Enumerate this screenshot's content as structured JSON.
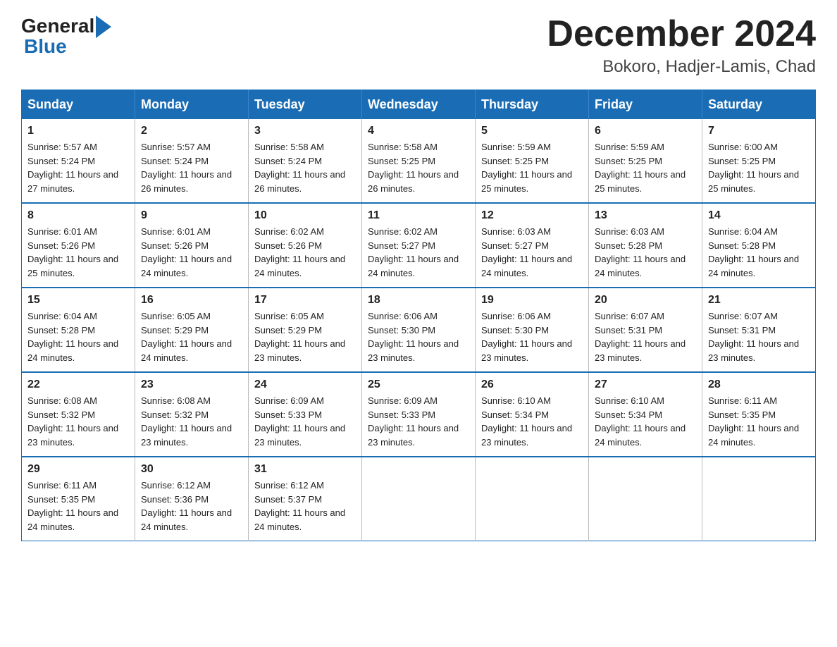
{
  "logo": {
    "general": "General",
    "blue": "Blue"
  },
  "title": "December 2024",
  "subtitle": "Bokoro, Hadjer-Lamis, Chad",
  "days_of_week": [
    "Sunday",
    "Monday",
    "Tuesday",
    "Wednesday",
    "Thursday",
    "Friday",
    "Saturday"
  ],
  "weeks": [
    [
      {
        "day": "1",
        "sunrise": "5:57 AM",
        "sunset": "5:24 PM",
        "daylight": "11 hours and 27 minutes."
      },
      {
        "day": "2",
        "sunrise": "5:57 AM",
        "sunset": "5:24 PM",
        "daylight": "11 hours and 26 minutes."
      },
      {
        "day": "3",
        "sunrise": "5:58 AM",
        "sunset": "5:24 PM",
        "daylight": "11 hours and 26 minutes."
      },
      {
        "day": "4",
        "sunrise": "5:58 AM",
        "sunset": "5:25 PM",
        "daylight": "11 hours and 26 minutes."
      },
      {
        "day": "5",
        "sunrise": "5:59 AM",
        "sunset": "5:25 PM",
        "daylight": "11 hours and 25 minutes."
      },
      {
        "day": "6",
        "sunrise": "5:59 AM",
        "sunset": "5:25 PM",
        "daylight": "11 hours and 25 minutes."
      },
      {
        "day": "7",
        "sunrise": "6:00 AM",
        "sunset": "5:25 PM",
        "daylight": "11 hours and 25 minutes."
      }
    ],
    [
      {
        "day": "8",
        "sunrise": "6:01 AM",
        "sunset": "5:26 PM",
        "daylight": "11 hours and 25 minutes."
      },
      {
        "day": "9",
        "sunrise": "6:01 AM",
        "sunset": "5:26 PM",
        "daylight": "11 hours and 24 minutes."
      },
      {
        "day": "10",
        "sunrise": "6:02 AM",
        "sunset": "5:26 PM",
        "daylight": "11 hours and 24 minutes."
      },
      {
        "day": "11",
        "sunrise": "6:02 AM",
        "sunset": "5:27 PM",
        "daylight": "11 hours and 24 minutes."
      },
      {
        "day": "12",
        "sunrise": "6:03 AM",
        "sunset": "5:27 PM",
        "daylight": "11 hours and 24 minutes."
      },
      {
        "day": "13",
        "sunrise": "6:03 AM",
        "sunset": "5:28 PM",
        "daylight": "11 hours and 24 minutes."
      },
      {
        "day": "14",
        "sunrise": "6:04 AM",
        "sunset": "5:28 PM",
        "daylight": "11 hours and 24 minutes."
      }
    ],
    [
      {
        "day": "15",
        "sunrise": "6:04 AM",
        "sunset": "5:28 PM",
        "daylight": "11 hours and 24 minutes."
      },
      {
        "day": "16",
        "sunrise": "6:05 AM",
        "sunset": "5:29 PM",
        "daylight": "11 hours and 24 minutes."
      },
      {
        "day": "17",
        "sunrise": "6:05 AM",
        "sunset": "5:29 PM",
        "daylight": "11 hours and 23 minutes."
      },
      {
        "day": "18",
        "sunrise": "6:06 AM",
        "sunset": "5:30 PM",
        "daylight": "11 hours and 23 minutes."
      },
      {
        "day": "19",
        "sunrise": "6:06 AM",
        "sunset": "5:30 PM",
        "daylight": "11 hours and 23 minutes."
      },
      {
        "day": "20",
        "sunrise": "6:07 AM",
        "sunset": "5:31 PM",
        "daylight": "11 hours and 23 minutes."
      },
      {
        "day": "21",
        "sunrise": "6:07 AM",
        "sunset": "5:31 PM",
        "daylight": "11 hours and 23 minutes."
      }
    ],
    [
      {
        "day": "22",
        "sunrise": "6:08 AM",
        "sunset": "5:32 PM",
        "daylight": "11 hours and 23 minutes."
      },
      {
        "day": "23",
        "sunrise": "6:08 AM",
        "sunset": "5:32 PM",
        "daylight": "11 hours and 23 minutes."
      },
      {
        "day": "24",
        "sunrise": "6:09 AM",
        "sunset": "5:33 PM",
        "daylight": "11 hours and 23 minutes."
      },
      {
        "day": "25",
        "sunrise": "6:09 AM",
        "sunset": "5:33 PM",
        "daylight": "11 hours and 23 minutes."
      },
      {
        "day": "26",
        "sunrise": "6:10 AM",
        "sunset": "5:34 PM",
        "daylight": "11 hours and 23 minutes."
      },
      {
        "day": "27",
        "sunrise": "6:10 AM",
        "sunset": "5:34 PM",
        "daylight": "11 hours and 24 minutes."
      },
      {
        "day": "28",
        "sunrise": "6:11 AM",
        "sunset": "5:35 PM",
        "daylight": "11 hours and 24 minutes."
      }
    ],
    [
      {
        "day": "29",
        "sunrise": "6:11 AM",
        "sunset": "5:35 PM",
        "daylight": "11 hours and 24 minutes."
      },
      {
        "day": "30",
        "sunrise": "6:12 AM",
        "sunset": "5:36 PM",
        "daylight": "11 hours and 24 minutes."
      },
      {
        "day": "31",
        "sunrise": "6:12 AM",
        "sunset": "5:37 PM",
        "daylight": "11 hours and 24 minutes."
      },
      null,
      null,
      null,
      null
    ]
  ]
}
